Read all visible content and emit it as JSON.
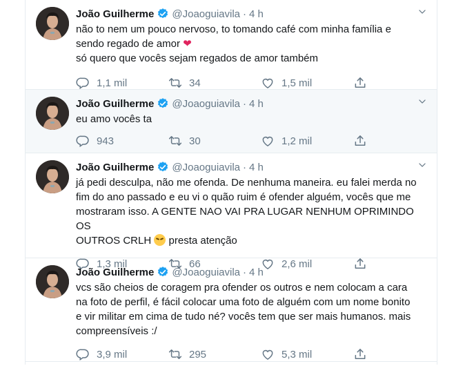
{
  "tweets": [
    {
      "name": "João Guilherme",
      "handle": "@Joaoguiavila",
      "dot": "·",
      "time": "4 h",
      "lines": [
        "não to nem um pouco nervoso, to tomando café com minha família e",
        "sendo regado de amor",
        "só quero que vocês sejam regados de amor também"
      ],
      "emoji": "❤",
      "replies": "1,1 mil",
      "retweets": "34",
      "likes": "1,5 mil"
    },
    {
      "name": "João Guilherme",
      "handle": "@Joaoguiavila",
      "dot": "·",
      "time": "4 h",
      "lines": [
        "eu amo vocês ta"
      ],
      "replies": "943",
      "retweets": "30",
      "likes": "1,2 mil"
    },
    {
      "name": "João Guilherme",
      "handle": "@Joaoguiavila",
      "dot": "·",
      "time": "4 h",
      "lines": [
        "já pedi desculpa, não me ofenda. De nenhuma maneira. eu falei merda no",
        "fim do ano passado e eu vi o quão ruim é ofender alguém, vocês que me",
        "mostraram isso. A GENTE NAO VAI PRA LUGAR NENHUM OPRIMINDO OS",
        "OUTROS CRLH",
        "presta atenção"
      ],
      "replies": "1,3 mil",
      "retweets": "66",
      "likes": "2,6 mil"
    },
    {
      "name": "João Guilherme",
      "handle": "@Joaoguiavila",
      "dot": "·",
      "time": "4 h",
      "lines": [
        "vcs são cheios de coragem pra ofender os outros e nem colocam a cara",
        "na foto de perfil, é fácil colocar uma foto de alguém com um nome bonito",
        "e vir militar em cima de tudo né? vocês tem que ser mais humanos. mais",
        "compreensíveis :/"
      ],
      "replies": "3,9 mil",
      "retweets": "295",
      "likes": "5,3 mil"
    }
  ],
  "colors": {
    "text": "#14171a",
    "secondary": "#657786",
    "verified": "#1da1f2",
    "border": "#e6ecf0",
    "highlight_bg": "#f5f8fa"
  },
  "icons": {
    "reply": "reply-icon",
    "retweet": "retweet-icon",
    "like": "heart-icon",
    "share": "share-icon",
    "verified": "verified-badge-icon",
    "caret": "chevron-down-icon"
  }
}
